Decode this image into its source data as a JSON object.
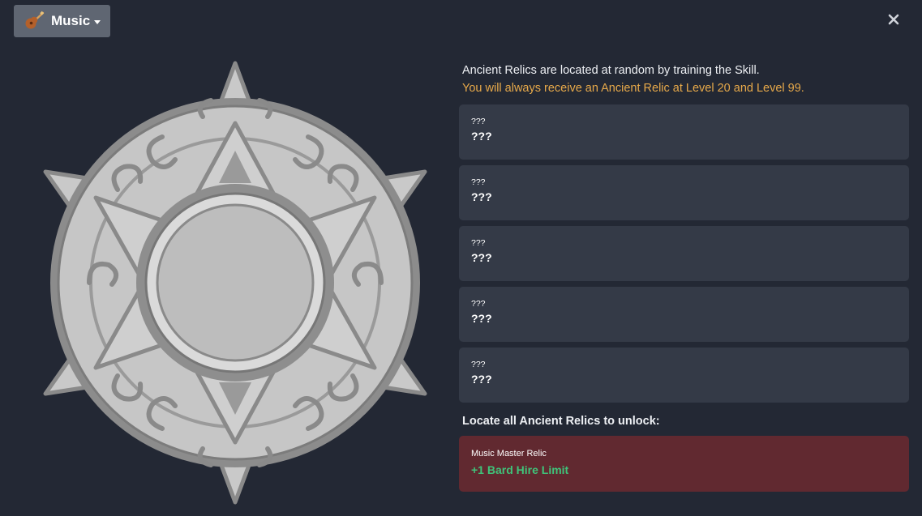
{
  "header": {
    "skill_name": "Music",
    "skill_icon": "guitar-icon",
    "close_icon": "close-icon"
  },
  "info": {
    "intro": "Ancient Relics are located at random by training the Skill.",
    "note": "You will always receive an Ancient Relic at Level 20 and Level 99."
  },
  "relics": [
    {
      "small": "???",
      "big": "???"
    },
    {
      "small": "???",
      "big": "???"
    },
    {
      "small": "???",
      "big": "???"
    },
    {
      "small": "???",
      "big": "???"
    },
    {
      "small": "???",
      "big": "???"
    }
  ],
  "unlock": {
    "title": "Locate all Ancient Relics to unlock:",
    "master_name": "Music Master Relic",
    "master_bonus": "+1 Bard Hire Limit"
  },
  "colors": {
    "background": "#232834",
    "card": "#343a47",
    "note": "#e7a94a",
    "master_card": "#612930",
    "bonus": "#3fc47a"
  }
}
